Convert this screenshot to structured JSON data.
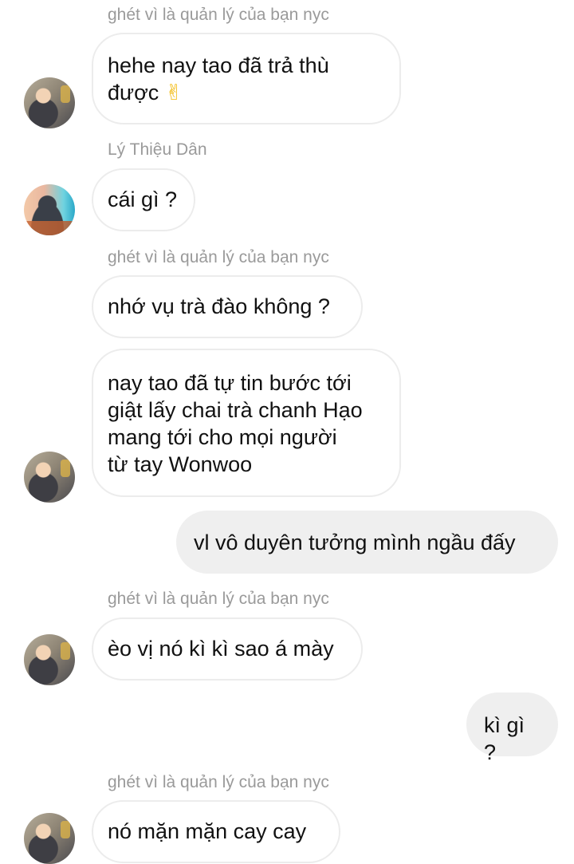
{
  "messages": [
    {
      "sender": "ghét vì là quản lý của bạn nyc",
      "text": "hehe nay tao đã trả thù\nđược",
      "emoji": "✌"
    },
    {
      "sender": "Lý Thiệu Dân",
      "text": "cái gì ?"
    },
    {
      "sender": "ghét vì là quản lý của bạn nyc",
      "text": "nhớ vụ trà đào không ?"
    },
    {
      "text": "nay tao đã tự tin bước tới\ngiật lấy chai trà chanh Hạo\nmang tới cho mọi người\ntừ tay Wonwoo"
    },
    {
      "text": "vl vô duyên tưởng mình ngầu đấy"
    },
    {
      "sender": "ghét vì là quản lý của bạn nyc",
      "text": "èo vị nó kì kì sao á mày"
    },
    {
      "text": "kì gì ?"
    },
    {
      "sender": "ghét vì là quản lý của bạn nyc",
      "text": "nó mặn mặn cay cay"
    }
  ]
}
